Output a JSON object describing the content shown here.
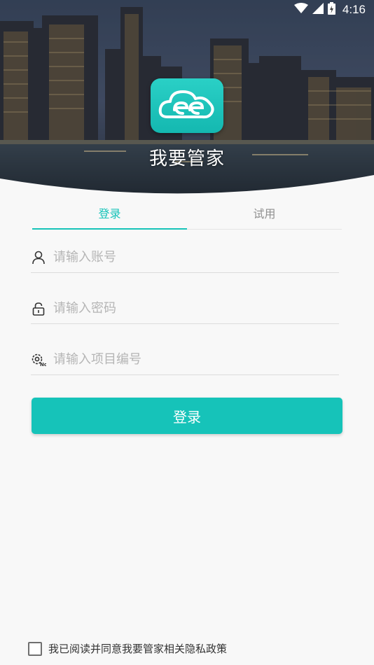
{
  "status_bar": {
    "time": "4:16",
    "icons": [
      "wifi-icon",
      "signal-icon",
      "battery-icon"
    ]
  },
  "hero": {
    "app_name": "我要管家",
    "logo_icon": "cloud-ee-logo-icon"
  },
  "tabs": [
    {
      "label": "登录",
      "active": true
    },
    {
      "label": "试用",
      "active": false
    }
  ],
  "form": {
    "account": {
      "placeholder": "请输入账号",
      "value": "",
      "icon": "user-icon"
    },
    "password": {
      "placeholder": "请输入密码",
      "value": "",
      "icon": "lock-icon"
    },
    "project": {
      "placeholder": "请输入项目编号",
      "value": "",
      "icon": "gear-no-icon"
    }
  },
  "login_button": {
    "label": "登录"
  },
  "agreement": {
    "label": "我已阅读并同意我要管家相关隐私政策",
    "checked": false
  },
  "colors": {
    "accent": "#16c3b9",
    "placeholder": "#b5b5b5",
    "background": "#f8f8f8"
  }
}
